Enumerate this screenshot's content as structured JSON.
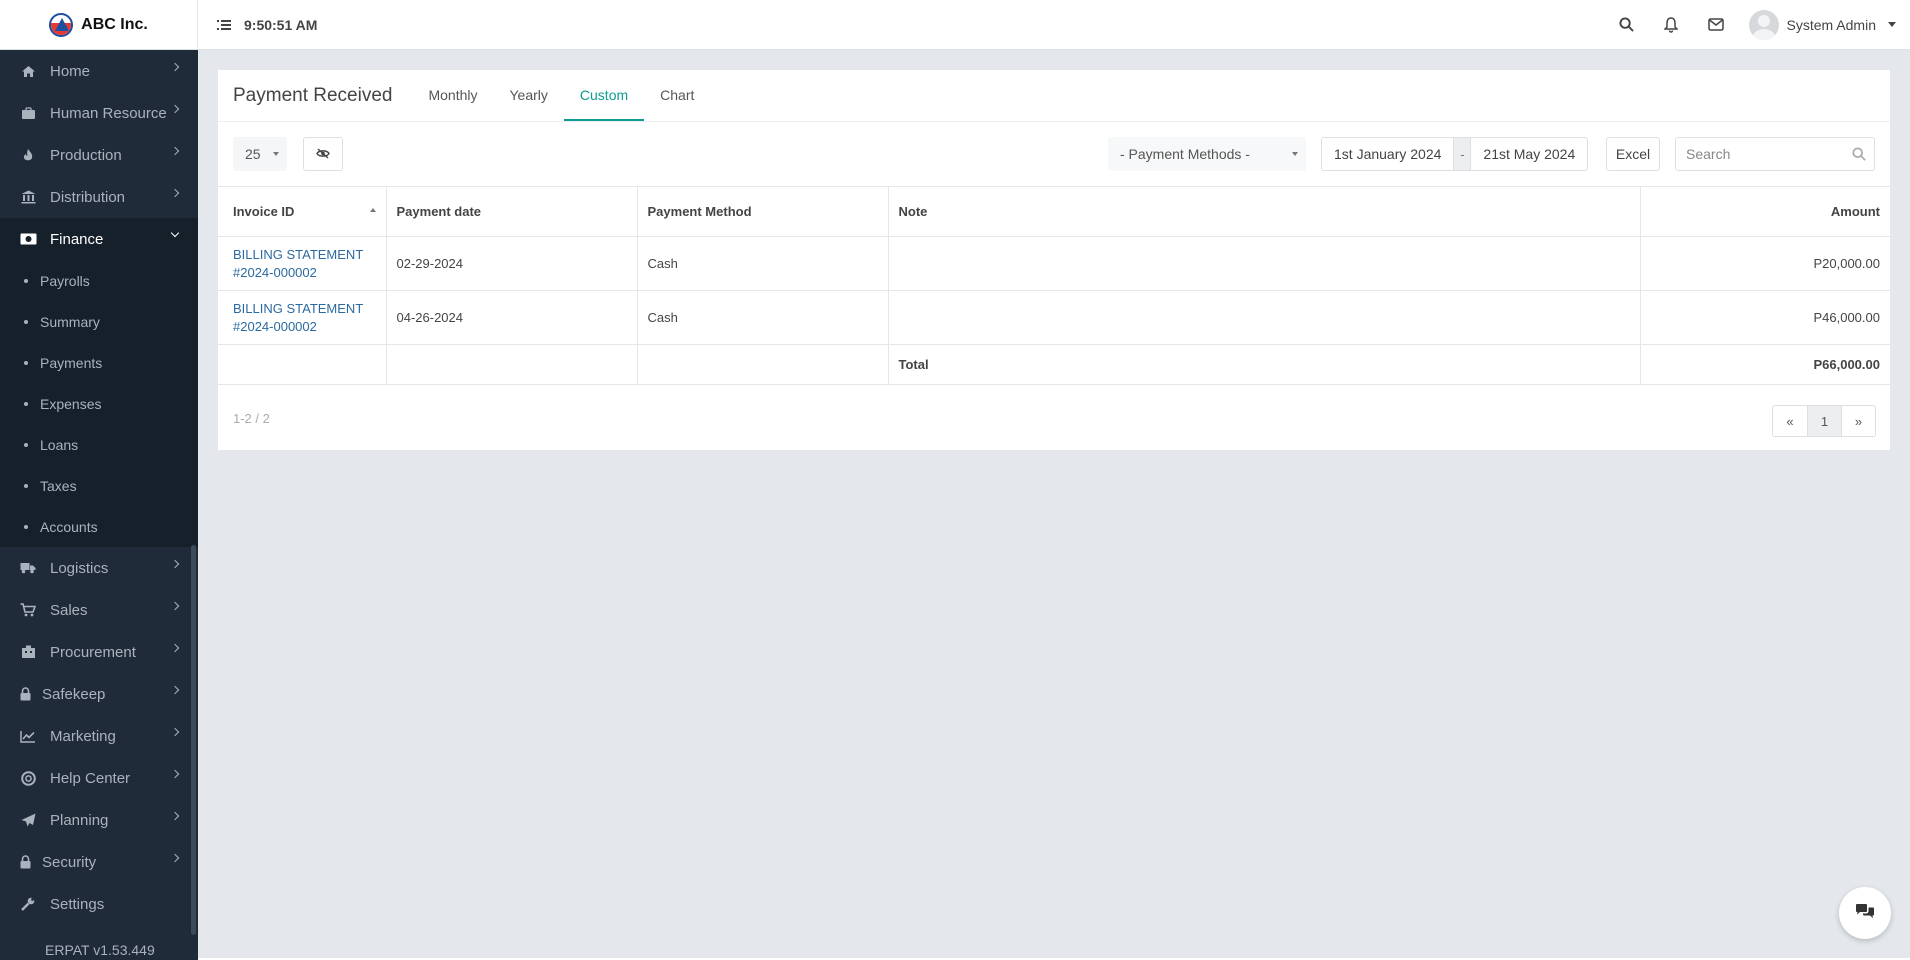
{
  "header": {
    "brand": "ABC Inc.",
    "time": "9:50:51 AM",
    "user_name": "System Admin",
    "icons": [
      "menu-toggle-icon",
      "search-icon",
      "bell-icon",
      "mail-icon"
    ]
  },
  "sidebar": {
    "items": [
      {
        "label": "Home",
        "icon": "home-icon"
      },
      {
        "label": "Human Resource",
        "icon": "briefcase-icon"
      },
      {
        "label": "Production",
        "icon": "fire-icon"
      },
      {
        "label": "Distribution",
        "icon": "bank-icon"
      },
      {
        "label": "Finance",
        "icon": "money-icon"
      },
      {
        "label": "Logistics",
        "icon": "truck-icon"
      },
      {
        "label": "Sales",
        "icon": "cart-icon"
      },
      {
        "label": "Procurement",
        "icon": "building-icon"
      },
      {
        "label": "Safekeep",
        "icon": "lock-icon"
      },
      {
        "label": "Marketing",
        "icon": "chart-line-icon"
      },
      {
        "label": "Help Center",
        "icon": "lifebuoy-icon"
      },
      {
        "label": "Planning",
        "icon": "paper-plane-icon"
      },
      {
        "label": "Security",
        "icon": "padlock-icon"
      },
      {
        "label": "Settings",
        "icon": "wrench-icon"
      }
    ],
    "finance_sub": [
      "Payrolls",
      "Summary",
      "Payments",
      "Expenses",
      "Loans",
      "Taxes",
      "Accounts"
    ],
    "version": "ERPAT v1.53.449"
  },
  "page": {
    "title": "Payment Received",
    "tabs": [
      "Monthly",
      "Yearly",
      "Custom",
      "Chart"
    ],
    "active_tab": "Custom"
  },
  "toolbar": {
    "page_size": "25",
    "payment_method_placeholder": "- Payment Methods -",
    "date_from": "1st January 2024",
    "date_sep": "-",
    "date_to": "21st May 2024",
    "excel_label": "Excel",
    "search_placeholder": "Search"
  },
  "table": {
    "columns": [
      "Invoice ID",
      "Payment date",
      "Payment Method",
      "Note",
      "Amount"
    ],
    "rows": [
      {
        "invoice_line1": "BILLING STATEMENT",
        "invoice_line2": "#2024-000002",
        "date": "02-29-2024",
        "method": "Cash",
        "note": "",
        "amount": "P20,000.00"
      },
      {
        "invoice_line1": "BILLING STATEMENT",
        "invoice_line2": "#2024-000002",
        "date": "04-26-2024",
        "method": "Cash",
        "note": "",
        "amount": "P46,000.00"
      }
    ],
    "total_label": "Total",
    "total_amount": "P66,000.00"
  },
  "footer": {
    "page_info": "1-2 / 2",
    "prev": "«",
    "current_page": "1",
    "next": "»"
  },
  "colors": {
    "sidebar_bg": "#1f2b38",
    "accent": "#0d9c8f",
    "link": "#2b6aa0",
    "page_bg": "#e4e8ec"
  }
}
